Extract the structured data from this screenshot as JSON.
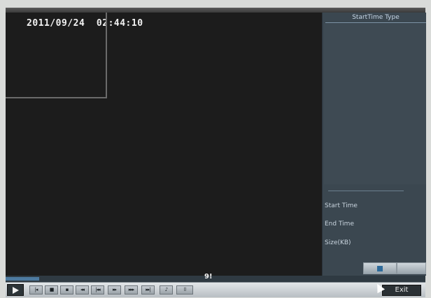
{
  "osd": {
    "timestamp": "2011/09/24  02:44:10"
  },
  "panel": {
    "header": "StartTime Type",
    "start_time_label": "Start Time",
    "end_time_label": "End Time",
    "size_label": "Size(KB)"
  },
  "playback": {
    "progress_label": "9!",
    "progress_fraction": 0.08
  },
  "controls": {
    "play_icon": "play-icon",
    "buttons": [
      {
        "name": "prev-frame-button",
        "glyph": "|◂"
      },
      {
        "name": "stop-button",
        "glyph": "■"
      },
      {
        "name": "pause-button",
        "glyph": "▪"
      },
      {
        "name": "fast-backward-button",
        "glyph": "◂◂"
      },
      {
        "name": "skip-back-button",
        "glyph": "|◂◂"
      },
      {
        "name": "slow-button",
        "glyph": "▸▸"
      },
      {
        "name": "fast-forward-button",
        "glyph": "▸▸▸"
      },
      {
        "name": "next-file-button",
        "glyph": "▸▸|"
      },
      {
        "name": "audio-button",
        "glyph": "♪"
      },
      {
        "name": "fullscreen-button",
        "glyph": "⌷"
      }
    ],
    "exit_label": "Exit"
  },
  "colors": {
    "panel_bg": "#3b4750",
    "progress_fill": "#4d7aa0",
    "video_bg": "#1c1c1c"
  }
}
